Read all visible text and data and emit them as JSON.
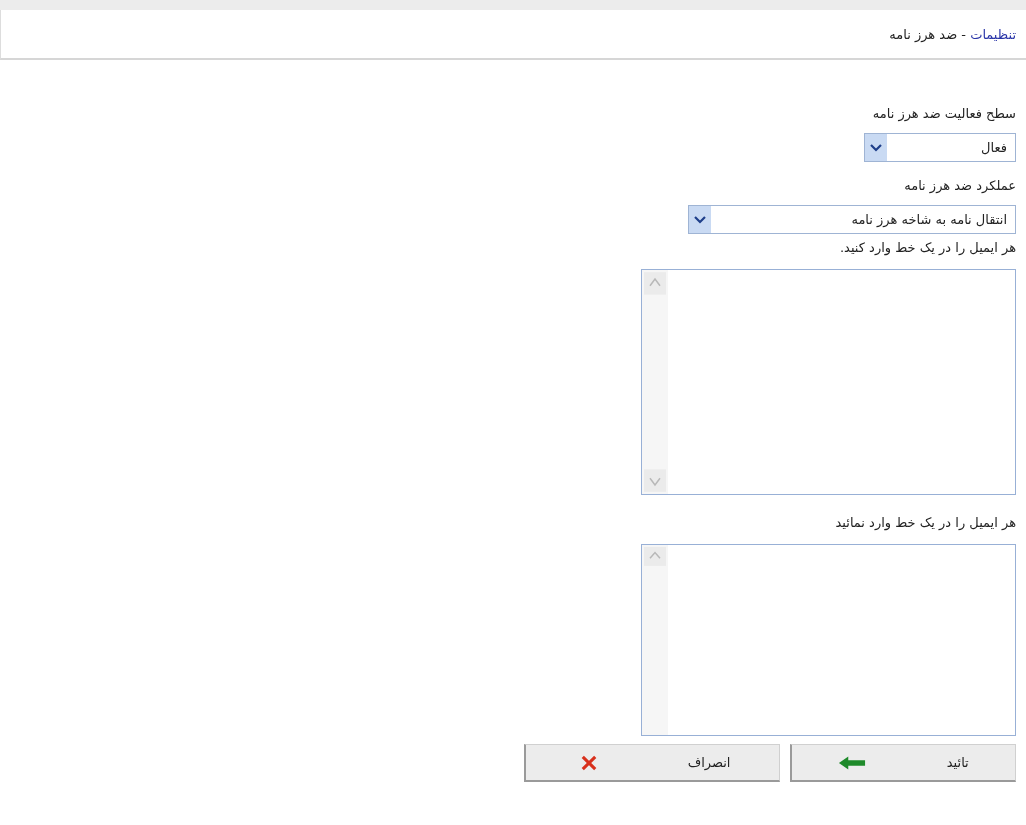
{
  "header": {
    "link": "تنظیمات",
    "separator": " - ",
    "title": "ضد هرز نامه"
  },
  "fields": [
    {
      "kind": "select",
      "label": "سطح فعالیت ضد هرز نامه",
      "value": "فعال"
    },
    {
      "kind": "select",
      "label": "عملکرد ضد هرز نامه",
      "value": "انتقال نامه به شاخه هرز نامه"
    },
    {
      "kind": "textarea",
      "label": "هر ایمیل را در یک خط وارد کنید.",
      "scroll_down": true
    },
    {
      "kind": "textarea",
      "label": "هر ایمیل را در یک خط وارد نمائید",
      "scroll_down": false
    }
  ],
  "buttons": [
    {
      "kind": "confirm",
      "label": "تائید"
    },
    {
      "kind": "cancel",
      "label": "انصراف"
    }
  ]
}
